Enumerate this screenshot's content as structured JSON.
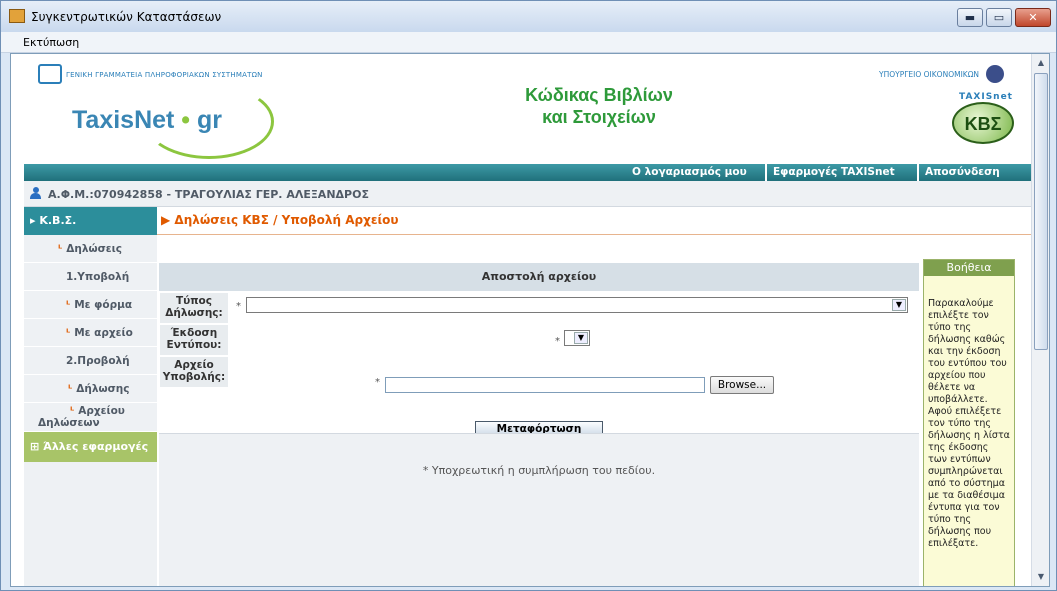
{
  "window": {
    "title": "Συγκεντρωτικών Καταστάσεων",
    "minimize": "▬",
    "maximize": "▭",
    "close": "✕"
  },
  "menu": {
    "print": "Εκτύπωση"
  },
  "banner": {
    "gs_text": "ΓΕΝΙΚΗ ΓΡΑΜΜΑΤΕΙΑ ΠΛΗΡΟΦΟΡΙΑΚΩΝ ΣΥΣΤΗΜΑΤΩΝ",
    "logo_taxis": "TaxisNet",
    "logo_gr": "gr",
    "headline_1": "Κώδικας Βιβλίων",
    "headline_2": "και Στοιχείων",
    "ministry": "ΥΠΟΥΡΓΕΙΟ ΟΙΚΟΝΟΜΙΚΩΝ",
    "kbs_top": "TAXISnet",
    "kbs": "ΚΒΣ"
  },
  "nav": {
    "account": "Ο λογαριασμός μου",
    "apps": "Εφαρμογές TAXISnet",
    "logout": "Αποσύνδεση"
  },
  "user": {
    "label": "Α.Φ.Μ.:070942858 - ΤΡΑΓΟΥΛΙΑΣ ΓΕΡ. ΑΛΕΞΑΝΔΡΟΣ"
  },
  "sidebar": {
    "head": "Κ.Β.Σ.",
    "items": [
      {
        "label": "Δηλώσεις"
      },
      {
        "label": "1.Υποβολή"
      },
      {
        "label": "Με φόρμα"
      },
      {
        "label": "Με αρχείο"
      },
      {
        "label": "2.Προβολή"
      },
      {
        "label": "Δήλωσης"
      },
      {
        "label_1": "Αρχείου",
        "label_2": "Δηλώσεων"
      }
    ],
    "other": "Άλλες εφαρμογές"
  },
  "breadcrumb": "Δηλώσεις ΚΒΣ / Υποβολή Αρχείου",
  "form": {
    "title": "Αποστολή αρχείου",
    "type_label_1": "Τύπος",
    "type_label_2": "Δήλωσης:",
    "version_label_1": "Έκδοση",
    "version_label_2": "Εντύπου:",
    "file_label_1": "Αρχείο",
    "file_label_2": "Υποβολής:",
    "required_star": "*",
    "browse": "Browse...",
    "upload": "Μεταφόρτωση",
    "required_note": "* Υποχρεωτική η συμπλήρωση του πεδίου."
  },
  "help": {
    "title": "Βοήθεια",
    "text": "Παρακαλούμε επιλέξτε τον τύπο της δήλωσης καθώς και την έκδοση του εντύπου του αρχείου που θέλετε να υποβάλλετε. Αφού επιλέξετε τον τύπο της δήλωσης η λίστα της έκδοσης των εντύπων συμπληρώνεται από το σύστημα με τα διαθέσιμα έντυπα για τον τύπο της δήλωσης που επιλέξατε."
  }
}
